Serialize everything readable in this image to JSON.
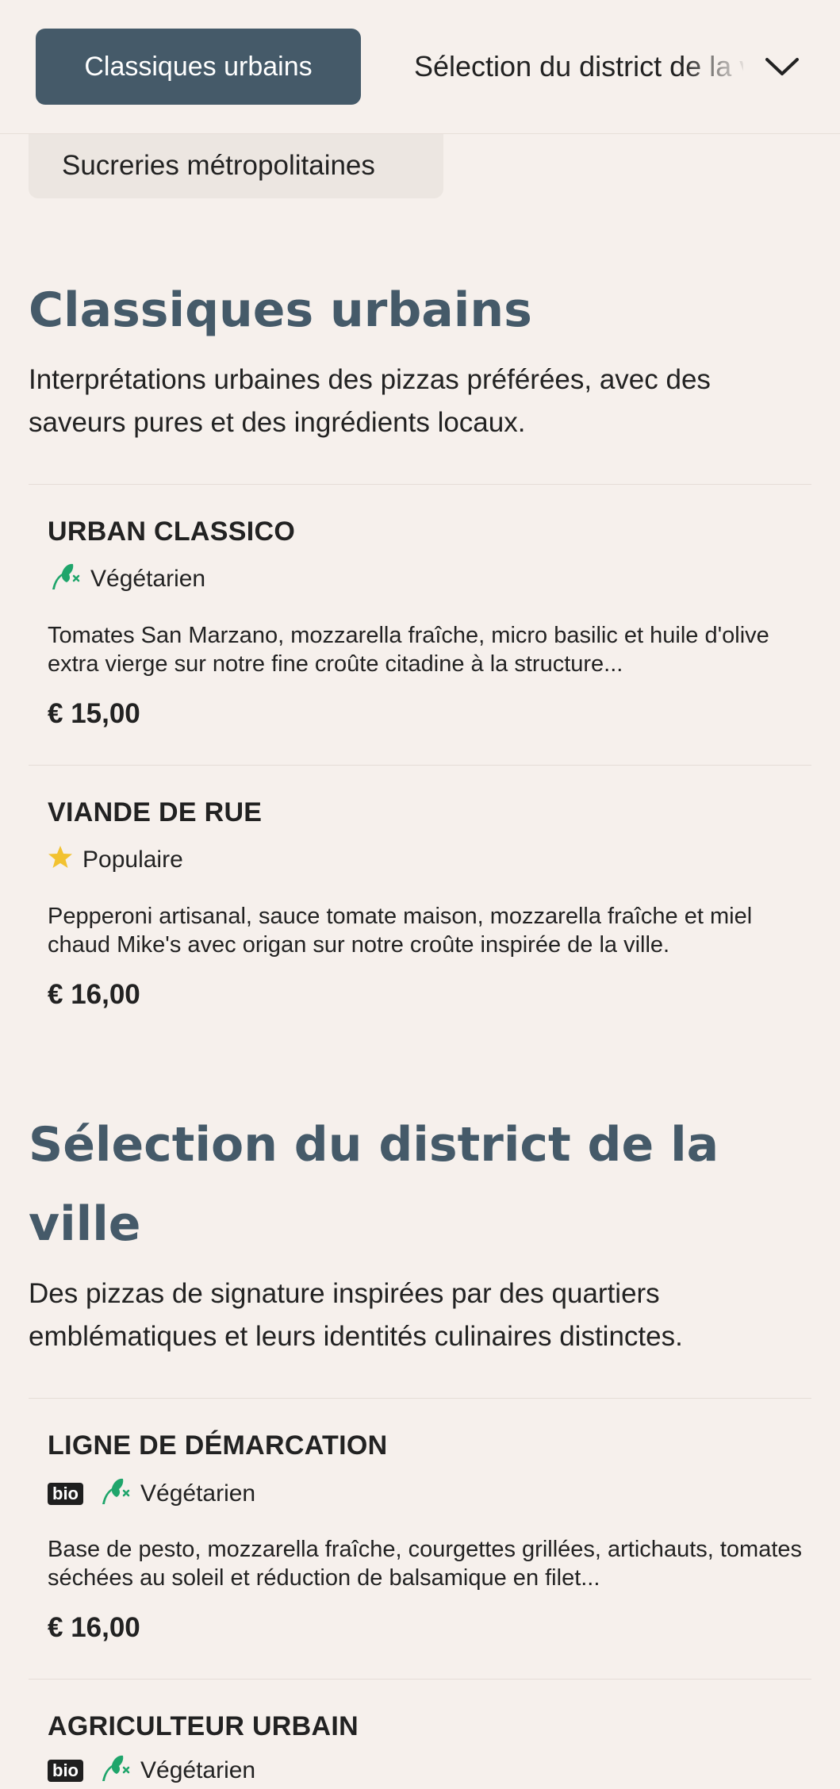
{
  "nav": {
    "tabs": [
      {
        "label": "Classiques urbains",
        "active": true
      },
      {
        "label": "Sélection du district de la ville",
        "active": false
      },
      {
        "label": "Sucreries métropolitaines",
        "active": false
      }
    ],
    "active_color": "#455a69"
  },
  "sections": [
    {
      "title": "Classiques urbains",
      "description": "Interprétations urbaines des pizzas préférées, avec des saveurs pures et des ingrédients locaux.",
      "items": [
        {
          "name": "URBAN CLASSICO",
          "tags": [
            {
              "icon": "vegetarian-icon",
              "label": "Végétarien"
            }
          ],
          "description": "Tomates San Marzano, mozzarella fraîche, micro basilic et huile d'olive extra vierge sur notre fine croûte citadine à la structure...",
          "price": "€ 15,00"
        },
        {
          "name": "VIANDE DE RUE",
          "tags": [
            {
              "icon": "star-icon",
              "label": "Populaire"
            }
          ],
          "description": "Pepperoni artisanal, sauce tomate maison, mozzarella fraîche et miel chaud Mike's avec origan sur notre croûte inspirée de la ville.",
          "price": "€ 16,00"
        }
      ]
    },
    {
      "title_line1": "Sélection du district de la",
      "title_line2": "ville",
      "description": "Des pizzas de signature inspirées par des quartiers emblématiques et leurs identités culinaires distinctes.",
      "items": [
        {
          "name": "LIGNE DE DÉMARCATION",
          "badge": "bio",
          "tags": [
            {
              "icon": "vegetarian-icon",
              "label": "Végétarien"
            }
          ],
          "description": "Base de pesto, mozzarella fraîche, courgettes grillées, artichauts, tomates séchées au soleil et réduction de balsamique en filet...",
          "price": "€ 16,00"
        },
        {
          "name": "AGRICULTEUR URBAIN",
          "badge": "bio",
          "tags": [
            {
              "icon": "vegetarian-icon",
              "label": "Végétarien"
            }
          ]
        }
      ]
    }
  ],
  "colors": {
    "background": "#f6f0ec",
    "vegetarian_green": "#1fa56b",
    "star_yellow": "#f2c230"
  }
}
